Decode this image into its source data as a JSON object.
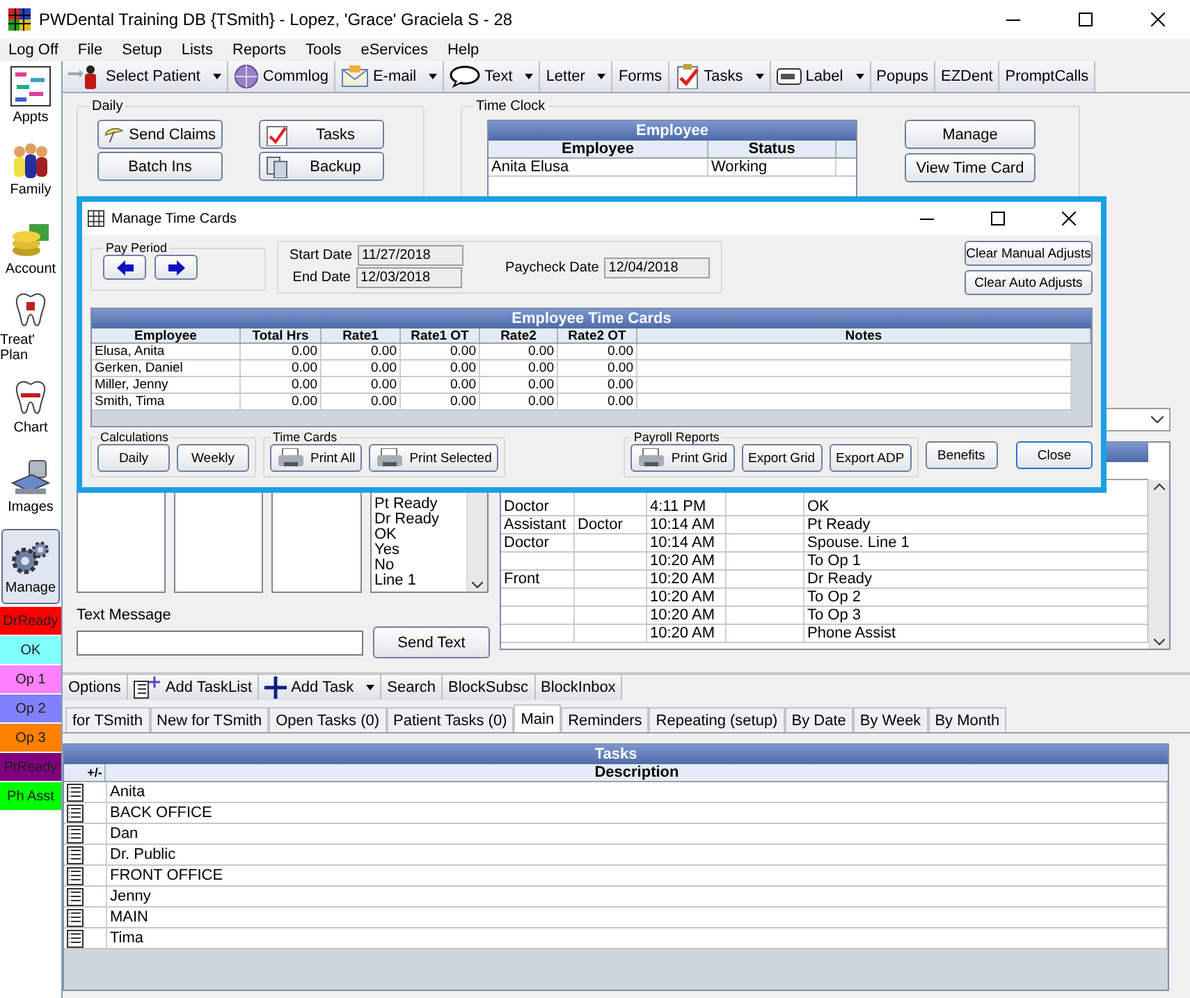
{
  "window": {
    "title": "PWDental Training DB {TSmith} - Lopez, 'Grace' Graciela S - 28"
  },
  "menu": [
    "Log Off",
    "File",
    "Setup",
    "Lists",
    "Reports",
    "Tools",
    "eServices",
    "Help"
  ],
  "toolbar": [
    {
      "label": "Select Patient",
      "dropdown": true
    },
    {
      "label": "Commlog",
      "dropdown": false
    },
    {
      "label": "E-mail",
      "dropdown": true
    },
    {
      "label": "Text",
      "dropdown": true
    },
    {
      "label": "Letter",
      "dropdown": true
    },
    {
      "label": "Forms",
      "dropdown": false
    },
    {
      "label": "Tasks",
      "dropdown": true
    },
    {
      "label": "Label",
      "dropdown": true
    },
    {
      "label": "Popups",
      "dropdown": false
    },
    {
      "label": "EZDent",
      "dropdown": false
    },
    {
      "label": "PromptCalls",
      "dropdown": false
    }
  ],
  "sidebar": {
    "modules": [
      {
        "label": "Appts",
        "selected": false
      },
      {
        "label": "Family",
        "selected": false
      },
      {
        "label": "Account",
        "selected": false
      },
      {
        "label": "Treat' Plan",
        "selected": false
      },
      {
        "label": "Chart",
        "selected": false
      },
      {
        "label": "Images",
        "selected": false
      },
      {
        "label": "Manage",
        "selected": true
      }
    ],
    "statuses": [
      {
        "label": "DrReady",
        "color": "#ff0000"
      },
      {
        "label": "OK",
        "color": "#80ffff"
      },
      {
        "label": "Op 1",
        "color": "#ff80ff"
      },
      {
        "label": "Op 2",
        "color": "#8080ff"
      },
      {
        "label": "Op 3",
        "color": "#ff8000"
      },
      {
        "label": "PtReady",
        "color": "#800080"
      },
      {
        "label": "Ph Asst",
        "color": "#00ff00"
      }
    ]
  },
  "daily": {
    "title": "Daily",
    "buttons": [
      {
        "label": "Send Claims"
      },
      {
        "label": "Tasks"
      },
      {
        "label": "Batch Ins"
      },
      {
        "label": "Backup"
      }
    ]
  },
  "time_clock": {
    "title": "Time Clock",
    "grid_title": "Employee",
    "columns": [
      "Employee",
      "Status"
    ],
    "rows": [
      [
        "Anita  Elusa",
        "Working"
      ]
    ],
    "buttons": [
      "Manage",
      "View Time Card"
    ]
  },
  "list_items": [
    "Pt Ready",
    "Dr Ready",
    "OK",
    "Yes",
    "No",
    "Line 1"
  ],
  "text_message": {
    "label": "Text Message",
    "button": "Send Text"
  },
  "messages": {
    "rows": [
      [
        "Doctor",
        "",
        "4:11 PM",
        "",
        "OK"
      ],
      [
        "Assistant",
        "Doctor",
        "10:14 AM",
        "",
        "Pt Ready"
      ],
      [
        "Doctor",
        "",
        "10:14 AM",
        "",
        "Spouse.  Line 1"
      ],
      [
        "",
        "",
        "10:20 AM",
        "",
        "To Op 1"
      ],
      [
        "Front",
        "",
        "10:20 AM",
        "",
        "Dr Ready"
      ],
      [
        "",
        "",
        "10:20 AM",
        "",
        "To Op 2"
      ],
      [
        "",
        "",
        "10:20 AM",
        "",
        "To Op 3"
      ],
      [
        "",
        "",
        "10:20 AM",
        "",
        "Phone Assist"
      ]
    ]
  },
  "task_toolbar": [
    {
      "label": "Options",
      "dropdown": false
    },
    {
      "label": "Add TaskList",
      "dropdown": false
    },
    {
      "label": "Add Task",
      "dropdown": true
    },
    {
      "label": "Search",
      "dropdown": false
    },
    {
      "label": "BlockSubsc",
      "dropdown": false
    },
    {
      "label": "BlockInbox",
      "dropdown": false
    }
  ],
  "task_tabs": [
    {
      "label": "for TSmith",
      "selected": false
    },
    {
      "label": "New for TSmith",
      "selected": false
    },
    {
      "label": "Open Tasks (0)",
      "selected": false
    },
    {
      "label": "Patient Tasks (0)",
      "selected": false
    },
    {
      "label": "Main",
      "selected": true
    },
    {
      "label": "Reminders",
      "selected": false
    },
    {
      "label": "Repeating (setup)",
      "selected": false
    },
    {
      "label": "By Date",
      "selected": false
    },
    {
      "label": "By Week",
      "selected": false
    },
    {
      "label": "By Month",
      "selected": false
    }
  ],
  "tasks": {
    "title": "Tasks",
    "columns": [
      "+/-",
      "Description"
    ],
    "rows": [
      "Anita",
      "BACK OFFICE",
      "Dan",
      "Dr. Public",
      "FRONT OFFICE",
      "Jenny",
      "MAIN",
      "Tima"
    ]
  },
  "dialog": {
    "title": "Manage Time Cards",
    "pay_period": "Pay Period",
    "start_date": {
      "label": "Start Date",
      "value": "11/27/2018"
    },
    "end_date": {
      "label": "End Date",
      "value": "12/03/2018"
    },
    "paycheck_date": {
      "label": "Paycheck Date",
      "value": "12/04/2018"
    },
    "adjust_buttons": [
      "Clear Manual Adjusts",
      "Clear Auto Adjusts"
    ],
    "grid": {
      "title": "Employee Time Cards",
      "columns": [
        "Employee",
        "Total Hrs",
        "Rate1",
        "Rate1 OT",
        "Rate2",
        "Rate2 OT",
        "Notes"
      ],
      "rows": [
        [
          "Elusa, Anita",
          "0.00",
          "0.00",
          "0.00",
          "0.00",
          "0.00"
        ],
        [
          "Gerken, Daniel",
          "0.00",
          "0.00",
          "0.00",
          "0.00",
          "0.00"
        ],
        [
          "Miller, Jenny",
          "0.00",
          "0.00",
          "0.00",
          "0.00",
          "0.00"
        ],
        [
          "Smith, Tima",
          "0.00",
          "0.00",
          "0.00",
          "0.00",
          "0.00"
        ]
      ]
    },
    "groups": [
      {
        "title": "Calculations",
        "buttons": [
          {
            "label": "Daily",
            "kind": "plain"
          },
          {
            "label": "Weekly",
            "kind": "plain"
          }
        ]
      },
      {
        "title": "Time Cards",
        "buttons": [
          {
            "label": "Print All",
            "kind": "printer"
          },
          {
            "label": "Print Selected",
            "kind": "printer"
          }
        ]
      },
      {
        "title": "Payroll Reports",
        "buttons": [
          {
            "label": "Print Grid",
            "kind": "printer"
          },
          {
            "label": "Export Grid",
            "kind": "plain"
          },
          {
            "label": "Export ADP",
            "kind": "plain"
          }
        ]
      }
    ],
    "buttons": [
      "Benefits",
      "Close"
    ]
  }
}
